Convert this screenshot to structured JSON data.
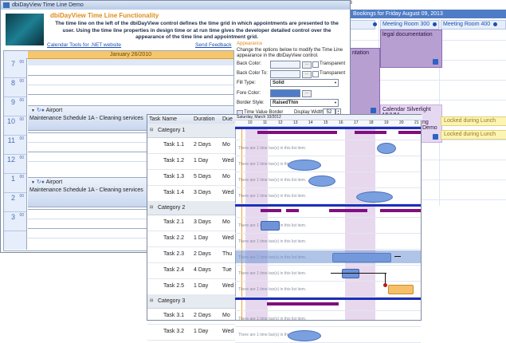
{
  "scheduler": {
    "header": "Bookings for Friday August 09, 2013",
    "rooms": [
      "Meeting Room 200",
      "Meeting Room 300",
      "Meeting Room 400"
    ],
    "appointments": [
      "legal documentation",
      "ntation",
      "Calendar Silverlight MVVM",
      "ng Demo"
    ],
    "lunch_items": [
      "Locked during Lunch",
      "Locked during Lunch"
    ],
    "title_fragment": "013"
  },
  "main_window": {
    "title": "dbiDayView Time Line Demo",
    "heading": "dbiDayView Time Line Functionality",
    "description": "The time line on the left of the dbiDayView control defines the time grid in which appointments are presented to the user.  Using the time line properties in design time or at run time gives the developer detailed control over the appearance of the time line and appointment grid.",
    "link_tools": "Calendar Tools for .NET website",
    "link_feedback": "Send Feedback",
    "date_header": "January 26/2010",
    "hours": [
      {
        "h": "7",
        "m": "00"
      },
      {
        "h": "8",
        "m": "00"
      },
      {
        "h": "9",
        "m": "00"
      },
      {
        "h": "10",
        "m": "00"
      },
      {
        "h": "11",
        "m": "00"
      },
      {
        "h": "12",
        "m": "00"
      },
      {
        "h": "1",
        "m": "00"
      },
      {
        "h": "2",
        "m": "00"
      },
      {
        "h": "3",
        "m": "00"
      }
    ],
    "appointments": [
      {
        "title": "Airport",
        "subtitle": "Maintenance Schedule 1A - Cleaning services"
      },
      {
        "title": "Airport",
        "subtitle": "Maintenance Schedule 1A - Cleaning services"
      }
    ]
  },
  "settings": {
    "section": "Appearance",
    "intro": "Change the options below to modify the Time Line appearance in the dbiDayView control.",
    "back_color": "Back Color:",
    "back_color_to": "Back Color To:",
    "transparent": "Transparent",
    "fill_type": "Fill Type:",
    "fill_type_value": "Solid",
    "fore_color": "Fore Color:",
    "border_style": "Border Style:",
    "border_style_value": "RaisedThin",
    "time_value_border": "Time Value Border",
    "display_width": "Display Width:",
    "display_width_value": "52",
    "dots": "..."
  },
  "gantt": {
    "columns": [
      "Task Name",
      "Duration",
      "Due D"
    ],
    "date_label": "Saturday, March 10/2012",
    "ticks": [
      "10",
      "11",
      "12",
      "13",
      "14",
      "15",
      "16",
      "17",
      "18",
      "19",
      "20",
      "21"
    ],
    "empty_text": "There are 1 time bar(s) in this list item.",
    "rows": [
      {
        "type": "category",
        "name": "Category 1"
      },
      {
        "type": "task",
        "name": "Task 1.1",
        "duration": "2 Days",
        "due": "Mo"
      },
      {
        "type": "task",
        "name": "Task 1.2",
        "duration": "1 Day",
        "due": "Wed"
      },
      {
        "type": "task",
        "name": "Task 1.3",
        "duration": "5 Days",
        "due": "Mo"
      },
      {
        "type": "task",
        "name": "Task 1.4",
        "duration": "3 Days",
        "due": "Wed"
      },
      {
        "type": "category",
        "name": "Category 2"
      },
      {
        "type": "task",
        "name": "Task 2.1",
        "duration": "3 Days",
        "due": "Mo"
      },
      {
        "type": "task",
        "name": "Task 2.2",
        "duration": "1 Day",
        "due": "Wed"
      },
      {
        "type": "task",
        "name": "Task 2.3",
        "duration": "2 Days",
        "due": "Thu"
      },
      {
        "type": "task",
        "name": "Task 2.4",
        "duration": "4 Days",
        "due": "Tue"
      },
      {
        "type": "task",
        "name": "Task 2.5",
        "duration": "1 Day",
        "due": "Wed"
      },
      {
        "type": "category",
        "name": "Category 3"
      },
      {
        "type": "task",
        "name": "Task 3.1",
        "duration": "2 Days",
        "due": "Mo"
      },
      {
        "type": "task",
        "name": "Task 3.2",
        "duration": "1 Day",
        "due": "Wed"
      }
    ]
  }
}
